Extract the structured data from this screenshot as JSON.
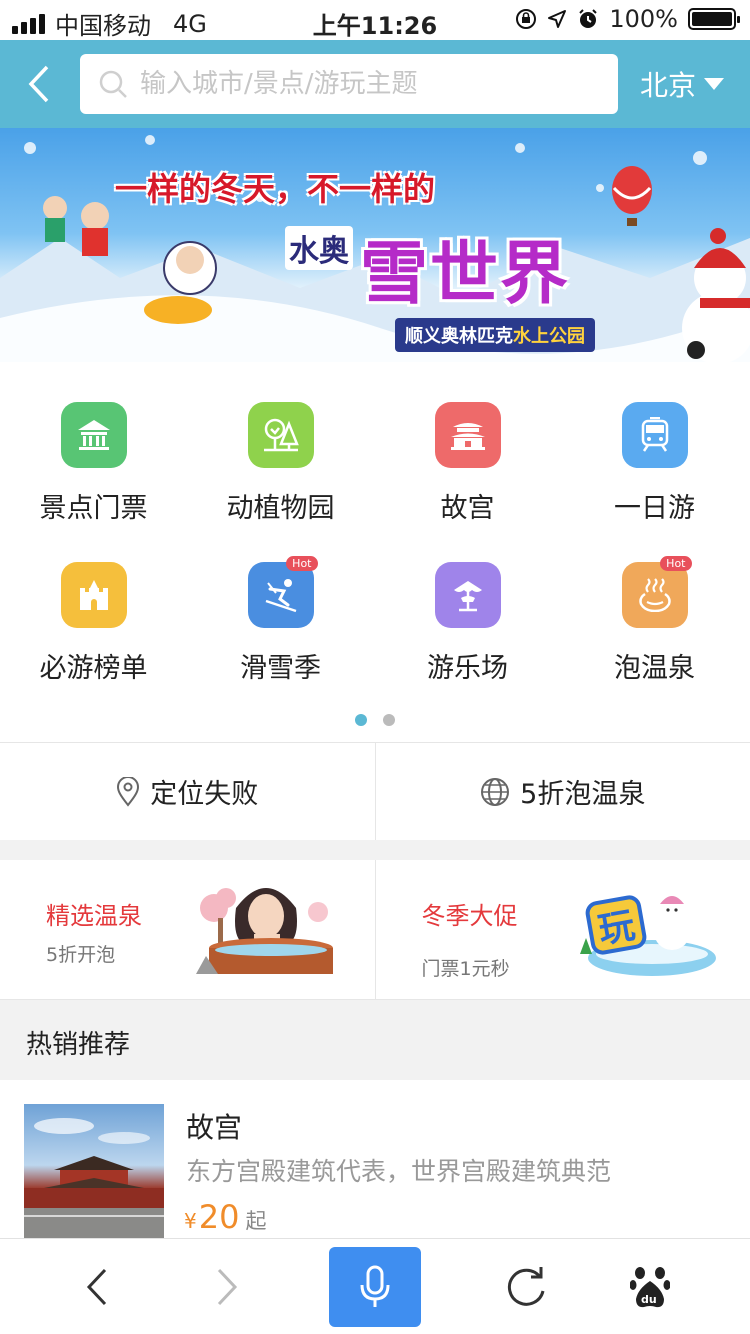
{
  "status_bar": {
    "carrier": "中国移动",
    "network": "4G",
    "time": "上午11:26",
    "battery": "100%"
  },
  "header": {
    "search_placeholder": "输入城市/景点/游玩主题",
    "city": "北京"
  },
  "banner": {
    "headline": "一样的冬天，不一样的",
    "brand": "水奥",
    "title": "雪世界",
    "location_prefix": "顺义奥林匹克",
    "location_highlight": "水上公园"
  },
  "categories": [
    {
      "label": "景点门票",
      "icon": "temple-icon",
      "color": "#58c574"
    },
    {
      "label": "动植物园",
      "icon": "tree-icon",
      "color": "#8fd24c"
    },
    {
      "label": "故宫",
      "icon": "palace-icon",
      "color": "#ee6a6a"
    },
    {
      "label": "一日游",
      "icon": "bus-icon",
      "color": "#5aaaf0"
    },
    {
      "label": "必游榜单",
      "icon": "castle-icon",
      "color": "#f5bf3c"
    },
    {
      "label": "滑雪季",
      "icon": "ski-icon",
      "color": "#4a8ee0",
      "badge": "Hot"
    },
    {
      "label": "游乐场",
      "icon": "carousel-icon",
      "color": "#9f84ea"
    },
    {
      "label": "泡温泉",
      "icon": "hot-spring-icon",
      "color": "#f0a85a",
      "badge": "Hot"
    }
  ],
  "pager": {
    "active_color": "#5bb8d4",
    "inactive_color": "#bbbbbb"
  },
  "location_row": {
    "locate_label": "定位失败",
    "promo_label": "5折泡温泉"
  },
  "promos": [
    {
      "title": "精选温泉",
      "subtitle": "5折开泡"
    },
    {
      "title": "冬季大促",
      "subtitle": "门票1元秒"
    }
  ],
  "hot_section": {
    "title": "热销推荐",
    "items": [
      {
        "name": "故宫",
        "desc": "东方宫殿建筑代表，世界宫殿建筑典范",
        "currency": "¥",
        "price": "20",
        "suffix": "起"
      }
    ]
  },
  "colors": {
    "header": "#5bb8d4",
    "accent_red": "#e4393c",
    "price": "#f08c2a",
    "mic": "#3f8ef0"
  }
}
